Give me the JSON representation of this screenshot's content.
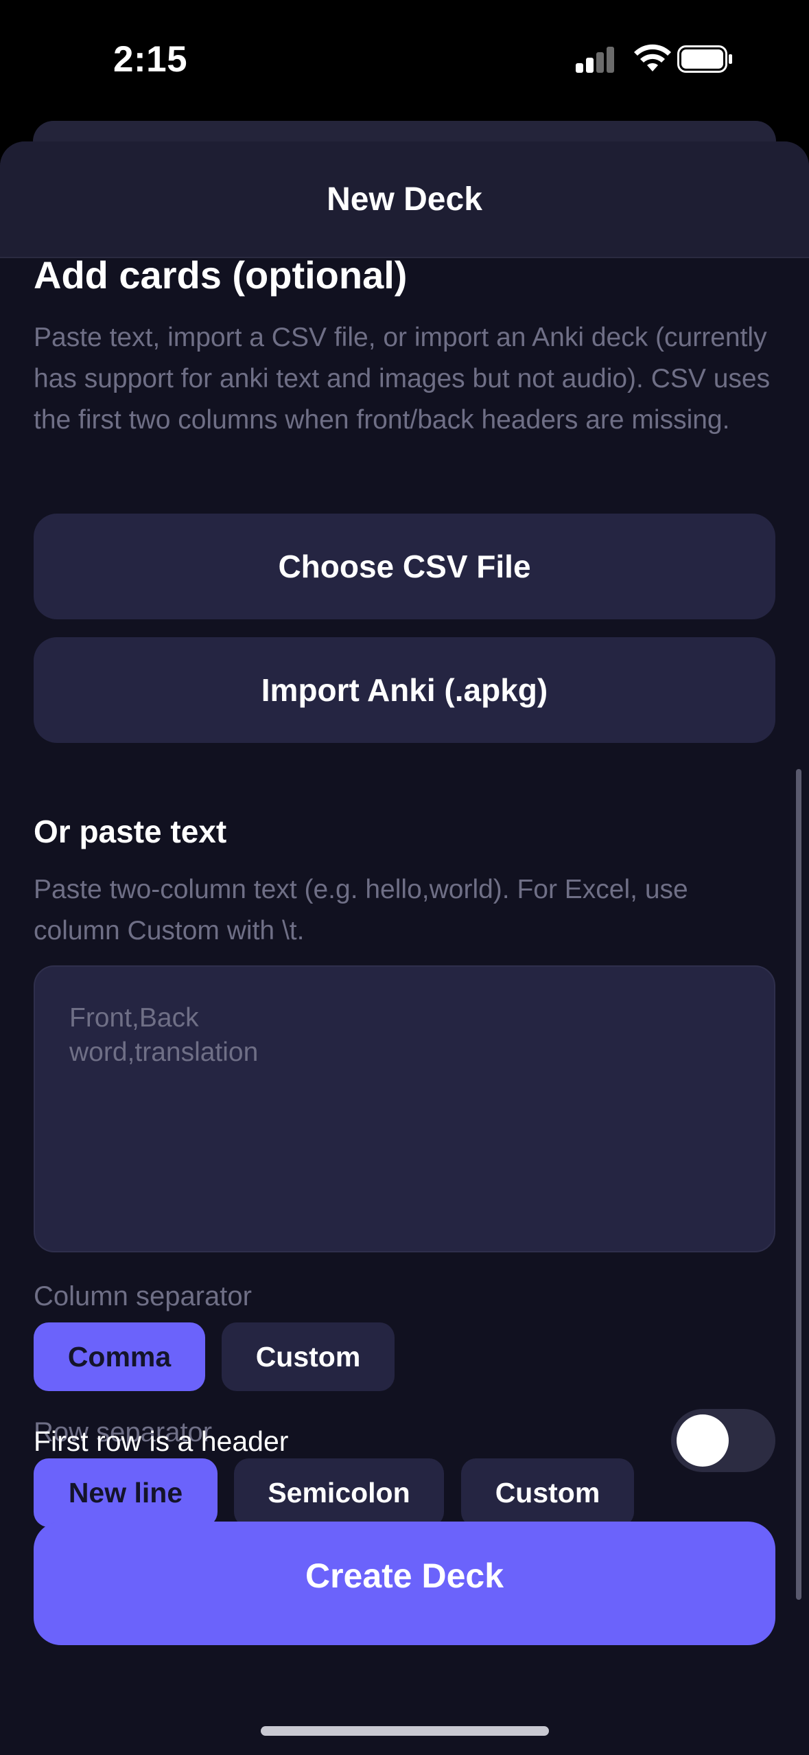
{
  "status_bar": {
    "time": "2:15",
    "icons": [
      "signal-icon",
      "wifi-icon",
      "battery-icon"
    ]
  },
  "sheet": {
    "title": "New Deck"
  },
  "add_cards": {
    "heading": "Add cards (optional)",
    "description": "Paste text, import a CSV file, or import an Anki deck (currently has support for anki text and images but not audio). CSV uses the first two columns when front/back headers are missing.",
    "choose_csv_label": "Choose CSV File",
    "import_anki_label": "Import Anki (.apkg)"
  },
  "paste": {
    "heading": "Or paste text",
    "description": "Paste two-column text (e.g. hello,world). For Excel, use column Custom with \\t.",
    "placeholder": "Front,Back\nword,translation"
  },
  "column_separator": {
    "label": "Column separator",
    "options": [
      "Comma",
      "Custom"
    ],
    "selected": "Comma"
  },
  "row_separator": {
    "label": "Row separator",
    "options": [
      "New line",
      "Semicolon",
      "Custom"
    ],
    "selected": "New line"
  },
  "header_toggle": {
    "label": "First row is a header",
    "on": false
  },
  "create_button_label": "Create Deck",
  "colors": {
    "accent": "#6b63fb",
    "background": "#111120",
    "surface": "#252542",
    "muted_text": "#6f6f86"
  }
}
